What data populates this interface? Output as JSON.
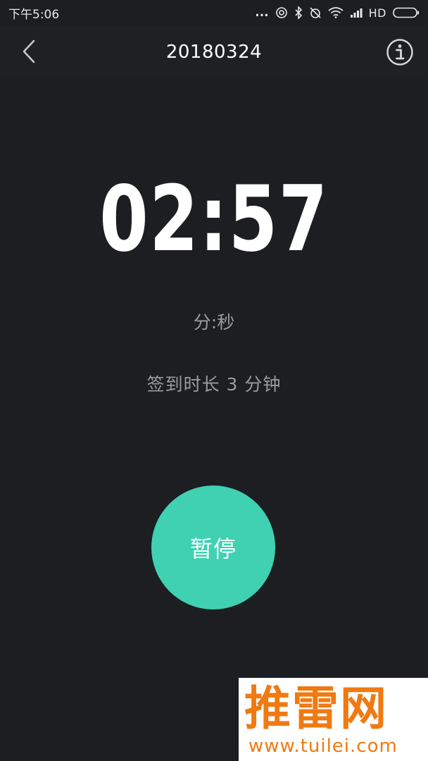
{
  "status_bar": {
    "time": "下午5:06",
    "dots": "...",
    "network": "HD"
  },
  "nav": {
    "title": "20180324",
    "back_icon": "chevron-left-icon",
    "info_icon": "info-circle-icon"
  },
  "timer": {
    "value": "02:57",
    "unit_label": "分:秒",
    "duration_text": "签到时长 3 分钟"
  },
  "pause_button": {
    "label": "暂停",
    "color": "#3fd1b2"
  },
  "watermark": {
    "logo_text": "推雷网",
    "url": "www.tuilei.com",
    "color": "#f07a12"
  },
  "colors": {
    "background": "#1c1e22",
    "nav_background": "#1e2024",
    "secondary_text": "#9a9ca0"
  }
}
